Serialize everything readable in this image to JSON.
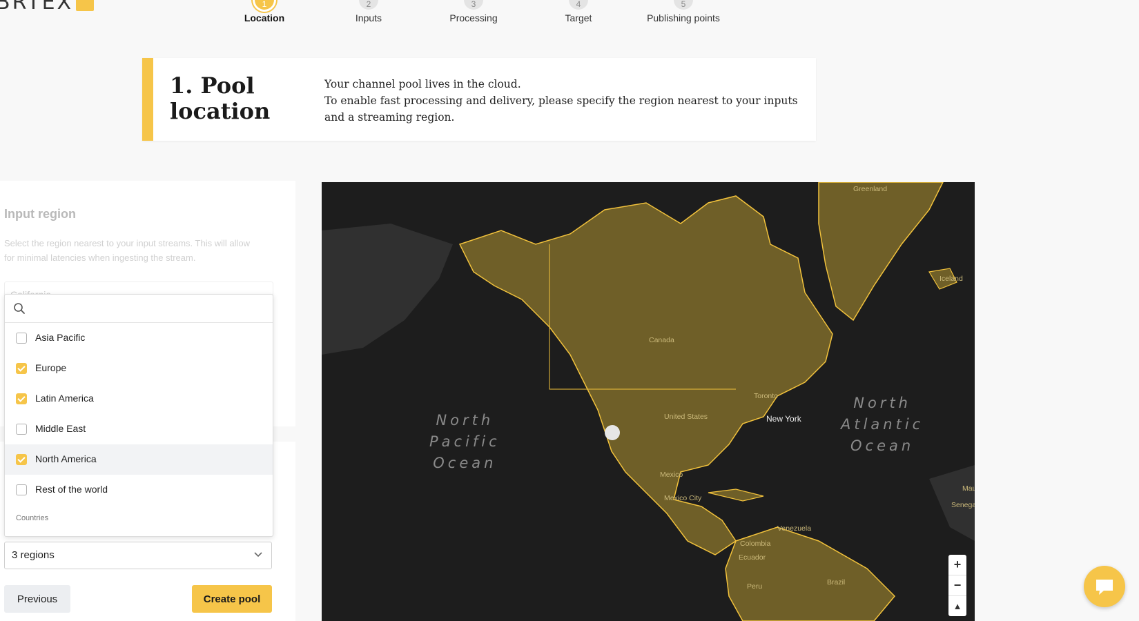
{
  "brand": {
    "logo_text": "BRTEX"
  },
  "steps": [
    {
      "number": "1",
      "label": "Location",
      "active": true
    },
    {
      "number": "2",
      "label": "Inputs",
      "active": false
    },
    {
      "number": "3",
      "label": "Processing",
      "active": false
    },
    {
      "number": "4",
      "label": "Target",
      "active": false
    },
    {
      "number": "5",
      "label": "Publishing points",
      "active": false
    }
  ],
  "intro": {
    "title_line1": "1. Pool",
    "title_line2": "location",
    "desc_line1": "Your channel pool lives in the cloud.",
    "desc_line2": "To enable fast processing and delivery, please specify the region nearest to your inputs",
    "desc_line3": "and a streaming region."
  },
  "input_region": {
    "title": "Input region",
    "help_line1": "Select the region nearest to your input streams. This will allow",
    "help_line2": "for minimal latencies when ingesting the stream.",
    "selected_value": "California"
  },
  "region_dropdown": {
    "search_value": "",
    "options": [
      {
        "label": "Asia Pacific",
        "checked": false
      },
      {
        "label": "Europe",
        "checked": true
      },
      {
        "label": "Latin America",
        "checked": true
      },
      {
        "label": "Middle East",
        "checked": false
      },
      {
        "label": "North America",
        "checked": true,
        "highlighted": true
      },
      {
        "label": "Rest of the world",
        "checked": false
      }
    ],
    "group_label": "Countries"
  },
  "streaming_select": {
    "value": "3 regions"
  },
  "buttons": {
    "previous": "Previous",
    "create": "Create pool"
  },
  "map": {
    "oceans": {
      "north_pacific": [
        "North",
        "Pacific",
        "Ocean"
      ],
      "north_atlantic": [
        "North",
        "Atlantic",
        "Ocean"
      ]
    },
    "labels": {
      "greenland": "Greenland",
      "iceland": "Iceland",
      "canada": "Canada",
      "united_states": "United States",
      "toronto": "Toronto",
      "new_york": "New York",
      "mexico": "Mexico",
      "mexico_city": "Mexico City",
      "venezuela": "Venezuela",
      "colombia": "Colombia",
      "ecuador": "Ecuador",
      "peru": "Peru",
      "brazil": "Brazil",
      "mauritania": "Mau",
      "senegal": "Senega"
    },
    "zoom": {
      "in": "+",
      "out": "−",
      "compass": "▲"
    },
    "colors": {
      "land": "#6f5f28",
      "border": "#f2c23c",
      "water": "#1d1d1d"
    }
  }
}
